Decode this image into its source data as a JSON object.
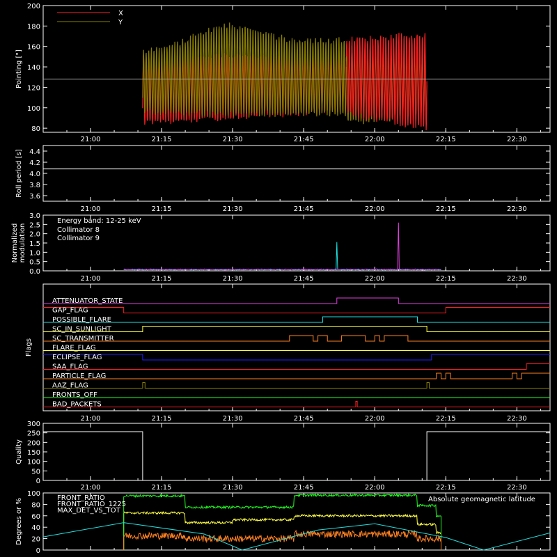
{
  "colors": {
    "background": "#000000",
    "axes": "#ffffff",
    "red": "#ff2020",
    "olive": "#8a7f00",
    "cyan": "#20e0e0",
    "magenta": "#e040e0",
    "green": "#20ff20",
    "yellow": "#ffff40",
    "orange": "#ff8020",
    "blue": "#2020ff",
    "white": "#ffffff"
  },
  "time_axis": {
    "range": [
      "20:50",
      "22:37"
    ],
    "ticks": [
      "21:00",
      "21:15",
      "21:30",
      "21:45",
      "22:00",
      "22:15",
      "22:30"
    ]
  },
  "chart_data": [
    {
      "id": "pointing",
      "type": "line",
      "ylabel": "Pointing [\"]",
      "ylim": [
        76,
        200
      ],
      "yticks": [
        80,
        100,
        120,
        140,
        160,
        180,
        200
      ],
      "reference_line": 128,
      "series": [
        {
          "name": "X",
          "color": "red",
          "segments": [
            {
              "start": "21:11",
              "end": "21:54",
              "center_start": 118,
              "center_end": 124,
              "amp_start": 36,
              "amp_end": 30
            },
            {
              "start": "21:54",
              "end": "22:11",
              "center_start": 130,
              "center_end": 126,
              "amp_start": 40,
              "amp_end": 50
            }
          ]
        },
        {
          "name": "Y",
          "color": "olive",
          "segments": [
            {
              "start": "21:11",
              "end": "21:54",
              "center_start": 125,
              "center_end": 130,
              "amp_start": 32,
              "amp_end": 40
            },
            {
              "start": "21:54",
              "end": "22:11",
              "center_start": 124,
              "center_end": 122,
              "amp_start": 42,
              "amp_end": 34
            }
          ]
        }
      ]
    },
    {
      "id": "roll",
      "type": "line",
      "ylabel": "Roll period [s]",
      "ylim": [
        3.5,
        4.5
      ],
      "yticks": [
        3.6,
        3.8,
        4.0,
        4.2,
        4.4
      ],
      "series": [
        {
          "name": "",
          "color": "white",
          "constant": 4.08
        }
      ]
    },
    {
      "id": "modulation",
      "type": "line",
      "ylabel": "Normalized modulation",
      "ylim": [
        0,
        3
      ],
      "yticks": [
        0.0,
        0.5,
        1.0,
        1.5,
        2.0,
        2.5,
        3.0
      ],
      "annotation": "Energy band: 12-25 keV",
      "series": [
        {
          "name": "Collimator 8",
          "color": "cyan",
          "baseline": 0.07,
          "start": "21:07",
          "end": "22:14",
          "spikes": [
            {
              "t": "21:52",
              "y": 1.55
            }
          ]
        },
        {
          "name": "Collimator 9",
          "color": "magenta",
          "baseline": 0.07,
          "start": "21:07",
          "end": "22:14",
          "spikes": [
            {
              "t": "22:05",
              "y": 2.6
            }
          ]
        }
      ]
    },
    {
      "id": "flags",
      "type": "line",
      "ylabel": "Flags",
      "flags": [
        {
          "name": "ATTENUATOR_STATE",
          "color": "magenta",
          "steps": [
            [
              "20:50",
              0
            ],
            [
              "21:52",
              1
            ],
            [
              "22:05",
              0
            ]
          ]
        },
        {
          "name": "GAP_FLAG",
          "color": "red",
          "steps": [
            [
              "20:50",
              1
            ],
            [
              "21:07",
              0
            ],
            [
              "22:15",
              1
            ]
          ]
        },
        {
          "name": "POSSIBLE_FLARE",
          "color": "cyan",
          "steps": [
            [
              "20:50",
              0
            ],
            [
              "21:49",
              1
            ],
            [
              "22:09",
              0
            ]
          ]
        },
        {
          "name": "SC_IN_SUNLIGHT",
          "color": "yellow",
          "steps": [
            [
              "20:50",
              0
            ],
            [
              "21:11",
              1
            ],
            [
              "22:11",
              0
            ]
          ]
        },
        {
          "name": "SC_TRANSMITTER",
          "color": "orange",
          "steps": [
            [
              "20:50",
              0
            ],
            [
              "21:42",
              1
            ],
            [
              "21:47",
              0
            ],
            [
              "21:48",
              1
            ],
            [
              "21:50",
              0
            ],
            [
              "21:53",
              1
            ],
            [
              "21:58",
              0
            ],
            [
              "22:00",
              1
            ],
            [
              "22:01",
              0
            ],
            [
              "22:02",
              1
            ],
            [
              "22:07",
              0
            ]
          ]
        },
        {
          "name": "FLARE_FLAG",
          "color": "yellow",
          "steps": [
            [
              "20:50",
              0
            ]
          ]
        },
        {
          "name": "ECLIPSE_FLAG",
          "color": "blue",
          "steps": [
            [
              "20:50",
              1
            ],
            [
              "21:11",
              0
            ],
            [
              "22:12",
              1
            ]
          ]
        },
        {
          "name": "SAA_FLAG",
          "color": "red",
          "steps": [
            [
              "20:50",
              0
            ],
            [
              "22:32",
              1
            ]
          ]
        },
        {
          "name": "PARTICLE_FLAG",
          "color": "orange",
          "steps": [
            [
              "20:50",
              0
            ],
            [
              "22:13",
              1
            ],
            [
              "22:14",
              0
            ],
            [
              "22:15",
              1
            ],
            [
              "22:16",
              0
            ],
            [
              "22:29",
              1
            ],
            [
              "22:30",
              0
            ],
            [
              "22:31",
              1
            ]
          ]
        },
        {
          "name": "AAZ_FLAG",
          "color": "olive",
          "steps": [
            [
              "20:50",
              0
            ],
            [
              "21:11",
              1
            ],
            [
              "21:11.5",
              0
            ],
            [
              "22:11",
              1
            ],
            [
              "22:11.5",
              0
            ]
          ]
        },
        {
          "name": "FRONTS_OFF",
          "color": "green",
          "steps": [
            [
              "20:50",
              0
            ]
          ]
        },
        {
          "name": "BAD_PACKETS",
          "color": "red",
          "steps": [
            [
              "20:50",
              0
            ],
            [
              "21:56",
              1
            ],
            [
              "21:56.3",
              0
            ]
          ]
        }
      ]
    },
    {
      "id": "quality",
      "type": "line",
      "ylabel": "Quality",
      "ylim": [
        0,
        300
      ],
      "yticks": [
        0,
        50,
        100,
        150,
        200,
        250,
        300
      ],
      "series": [
        {
          "name": "",
          "color": "white",
          "steps": [
            [
              "20:50",
              256
            ],
            [
              "21:11",
              0
            ],
            [
              "22:11",
              256
            ]
          ]
        }
      ]
    },
    {
      "id": "ratios",
      "type": "line",
      "ylabel": "Degrees or %",
      "ylim": [
        0,
        100
      ],
      "yticks": [
        0,
        20,
        40,
        60,
        80,
        100
      ],
      "series": [
        {
          "name": "FRONT_RATIO",
          "color": "yellow",
          "start": "21:07",
          "end": "22:14",
          "levels": [
            [
              "21:07",
              65
            ],
            [
              "21:20",
              48
            ],
            [
              "21:30",
              53
            ],
            [
              "21:43",
              60
            ],
            [
              "22:09",
              45
            ],
            [
              "22:13",
              30
            ]
          ]
        },
        {
          "name": "FRONT_RATIO_1225",
          "color": "green",
          "start": "21:07",
          "end": "22:14",
          "levels": [
            [
              "21:07",
              95
            ],
            [
              "21:20",
              75
            ],
            [
              "21:43",
              96
            ],
            [
              "22:09",
              78
            ],
            [
              "22:13",
              60
            ]
          ]
        },
        {
          "name": "MAX_DET_VS_TOT",
          "color": "orange",
          "start": "21:07",
          "end": "22:14",
          "levels": [
            [
              "21:07",
              25
            ],
            [
              "21:20",
              20
            ],
            [
              "21:43",
              28
            ],
            [
              "22:09",
              20
            ]
          ]
        },
        {
          "name": "Absolute geomagnetic latitude",
          "color": "cyan",
          "points": [
            [
              "20:50",
              23
            ],
            [
              "21:07",
              48
            ],
            [
              "21:24",
              28
            ],
            [
              "21:32",
              0
            ],
            [
              "21:48",
              35
            ],
            [
              "22:00",
              46
            ],
            [
              "22:15",
              22
            ],
            [
              "22:23",
              0
            ],
            [
              "22:37",
              30
            ]
          ]
        }
      ]
    }
  ]
}
